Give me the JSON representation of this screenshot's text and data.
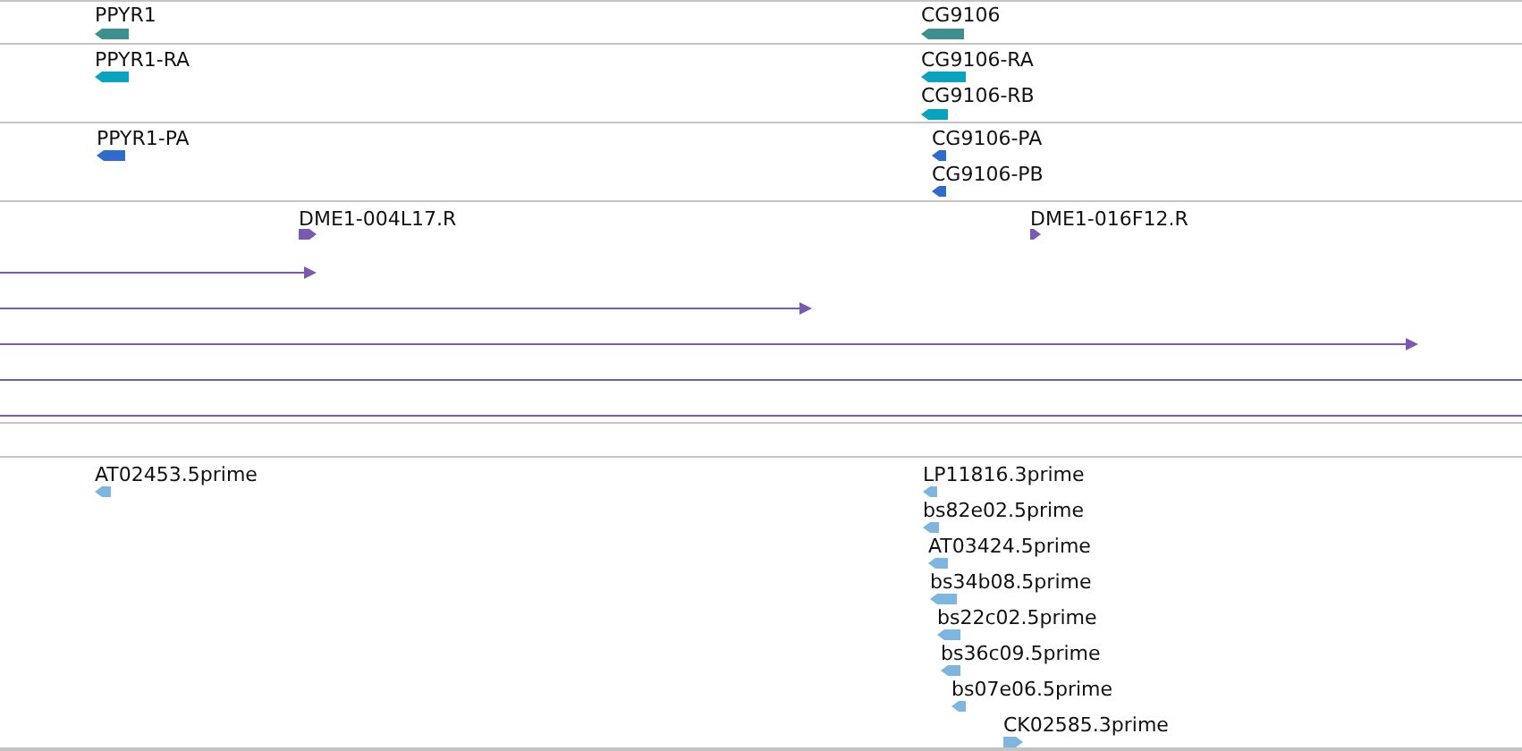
{
  "tracks": [
    {
      "kind": "features",
      "color": "#3f8f8f",
      "features": [
        {
          "kind": "feature",
          "label": "PPYR1",
          "forward": false
        },
        {
          "kind": "feature",
          "label": "CG9106",
          "forward": false
        }
      ]
    },
    {
      "kind": "features",
      "color": "#0aa3bf",
      "features": [
        {
          "kind": "feature",
          "label": "PPYR1-RA",
          "forward": false
        },
        {
          "kind": "feature",
          "label": "CG9106-RA",
          "forward": false
        },
        {
          "kind": "feature",
          "label": "CG9106-RB",
          "forward": false
        }
      ]
    },
    {
      "kind": "features",
      "color": "#2f6acd",
      "features": [
        {
          "kind": "feature",
          "label": "PPYR1-PA",
          "forward": false
        },
        {
          "kind": "feature",
          "label": "CG9106-PA",
          "forward": false
        },
        {
          "kind": "feature",
          "label": "CG9106-PB",
          "forward": false
        }
      ]
    },
    {
      "kind": "features",
      "color": "#7a5aae",
      "features": [
        {
          "kind": "feature",
          "label": "DME1-004L17.R",
          "forward": true
        },
        {
          "kind": "feature",
          "label": "DME1-016F12.R",
          "forward": true
        },
        {
          "kind": "line",
          "arrowhead": true
        },
        {
          "kind": "line",
          "arrowhead": true
        },
        {
          "kind": "line",
          "arrowhead": true
        },
        {
          "kind": "line",
          "arrowhead": false
        },
        {
          "kind": "line",
          "arrowhead": false
        }
      ]
    },
    {
      "kind": "empty"
    },
    {
      "kind": "features",
      "color": "#7fb6e0",
      "features": [
        {
          "kind": "feature",
          "label": "AT02453.5prime",
          "forward": false
        },
        {
          "kind": "feature",
          "label": "LP11816.3prime",
          "forward": false
        },
        {
          "kind": "feature",
          "label": "bs82e02.5prime",
          "forward": false
        },
        {
          "kind": "feature",
          "label": "AT03424.5prime",
          "forward": false
        },
        {
          "kind": "feature",
          "label": "bs34b08.5prime",
          "forward": false
        },
        {
          "kind": "feature",
          "label": "bs22c02.5prime",
          "forward": false
        },
        {
          "kind": "feature",
          "label": "bs36c09.5prime",
          "forward": false
        },
        {
          "kind": "feature",
          "label": "bs07e06.5prime",
          "forward": false
        },
        {
          "kind": "feature",
          "label": "CK02585.3prime",
          "forward": true
        }
      ]
    }
  ]
}
